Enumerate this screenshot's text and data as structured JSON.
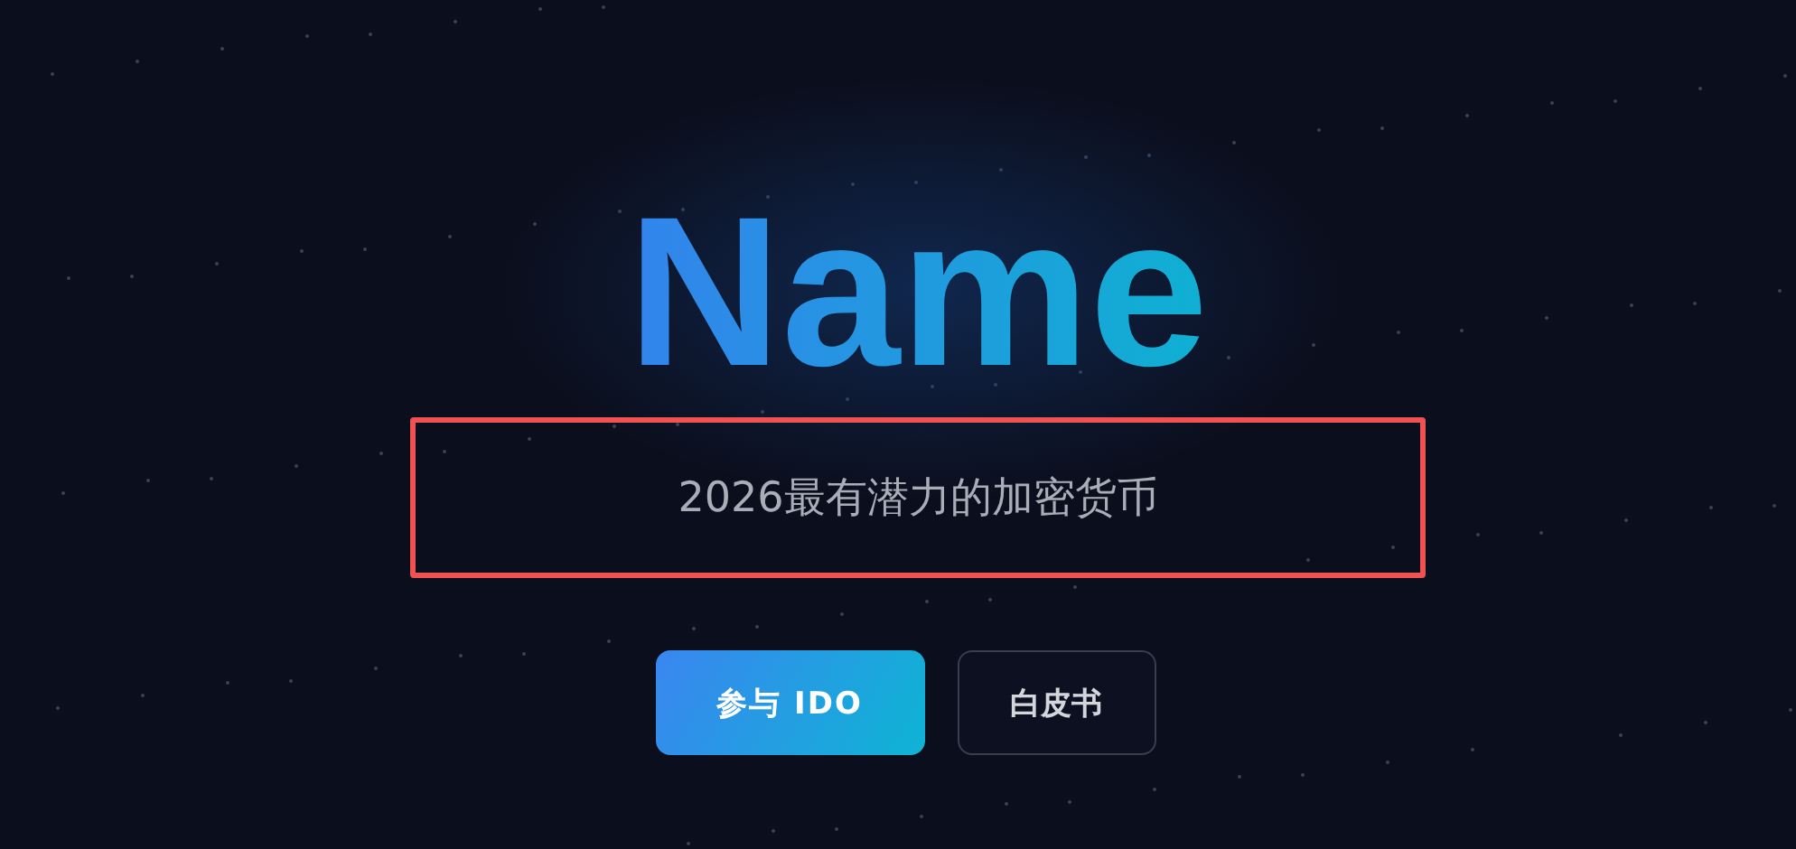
{
  "hero": {
    "title": "Name",
    "subtitle": "2026最有潜力的加密货币",
    "highlighted": true
  },
  "buttons": [
    {
      "label": "参与 IDO",
      "kind": "primary"
    },
    {
      "label": "白皮书",
      "kind": "outline"
    }
  ]
}
